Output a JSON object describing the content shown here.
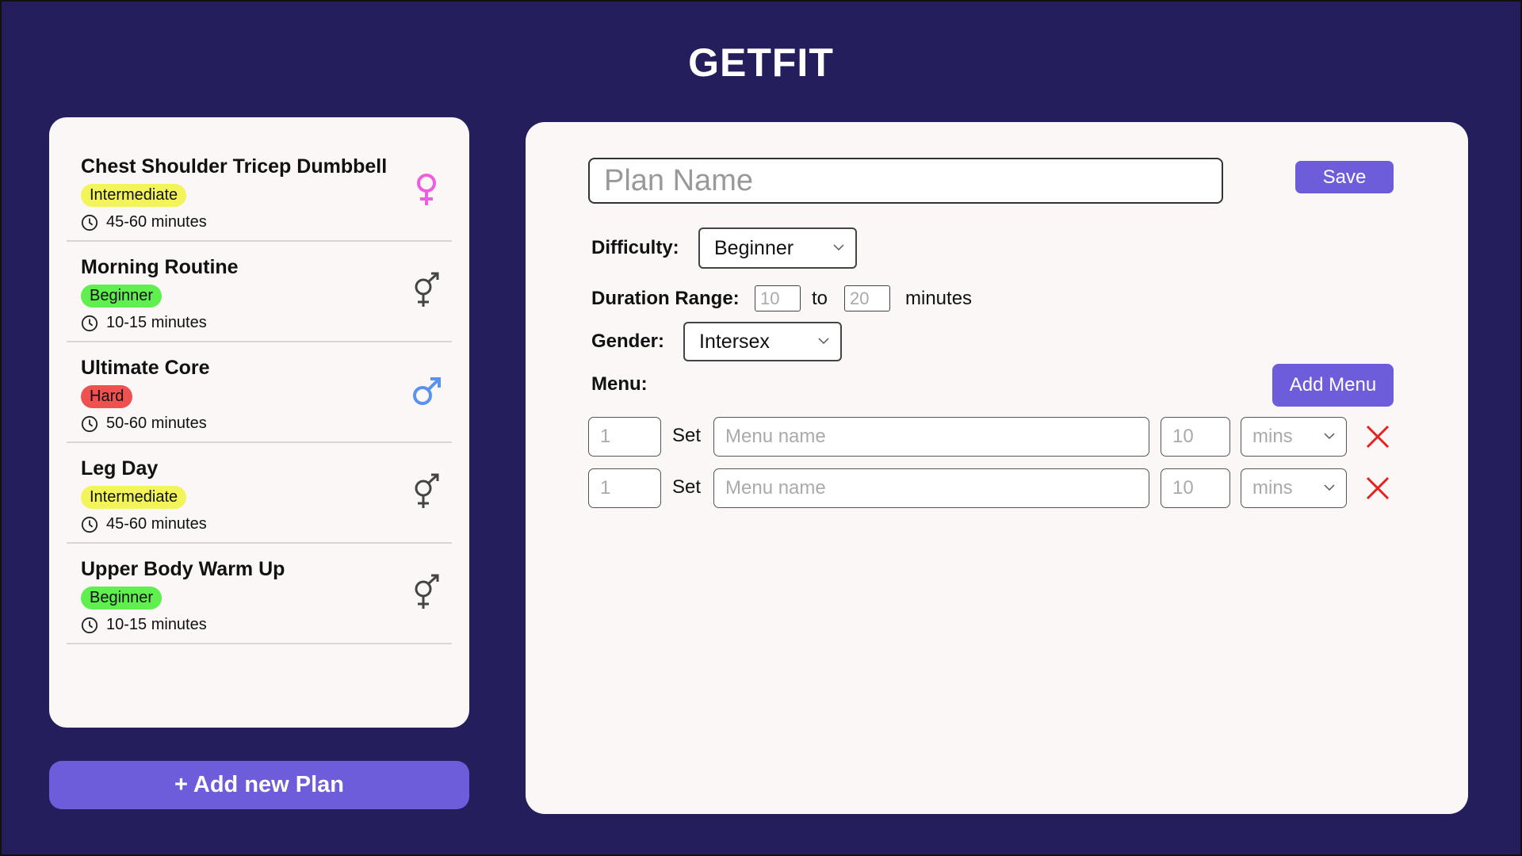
{
  "app": {
    "title": "GETFIT"
  },
  "plans": [
    {
      "name": "Chest Shoulder Tricep Dumbbell",
      "difficulty": "Intermediate",
      "duration": "45-60 minutes",
      "gender_icon": "female-icon"
    },
    {
      "name": "Morning Routine",
      "difficulty": "Beginner",
      "duration": "10-15 minutes",
      "gender_icon": "intersex-icon"
    },
    {
      "name": "Ultimate Core",
      "difficulty": "Hard",
      "duration": "50-60 minutes",
      "gender_icon": "male-icon"
    },
    {
      "name": "Leg Day",
      "difficulty": "Intermediate",
      "duration": "45-60 minutes",
      "gender_icon": "intersex-icon"
    },
    {
      "name": "Upper Body Warm Up",
      "difficulty": "Beginner",
      "duration": "10-15 minutes",
      "gender_icon": "intersex-icon"
    }
  ],
  "difficulty_colors": {
    "Intermediate": "#f3f35a",
    "Beginner": "#5fef4f",
    "Hard": "#ef5050"
  },
  "gender_colors": {
    "female": "#ee5fe0",
    "male": "#5b92ee",
    "intersex": "#444444"
  },
  "add_plan_label": "+ Add new Plan",
  "editor": {
    "plan_name_placeholder": "Plan Name",
    "save_label": "Save",
    "difficulty_label": "Difficulty:",
    "difficulty_value": "Beginner",
    "duration_label": "Duration Range:",
    "duration_min_placeholder": "10",
    "duration_to": "to",
    "duration_max_placeholder": "20",
    "duration_unit": "minutes",
    "gender_label": "Gender:",
    "gender_value": "Intersex",
    "menu_label": "Menu:",
    "add_menu_label": "Add Menu",
    "menu_rows": [
      {
        "sets_placeholder": "1",
        "set_label": "Set",
        "name_placeholder": "Menu name",
        "amount_placeholder": "10",
        "unit_placeholder": "mins"
      },
      {
        "sets_placeholder": "1",
        "set_label": "Set",
        "name_placeholder": "Menu name",
        "amount_placeholder": "10",
        "unit_placeholder": "mins"
      }
    ]
  },
  "colors": {
    "background": "#241f5c",
    "accent": "#6d5ddb",
    "panel": "#fbf7f6",
    "delete": "#e8201e"
  }
}
